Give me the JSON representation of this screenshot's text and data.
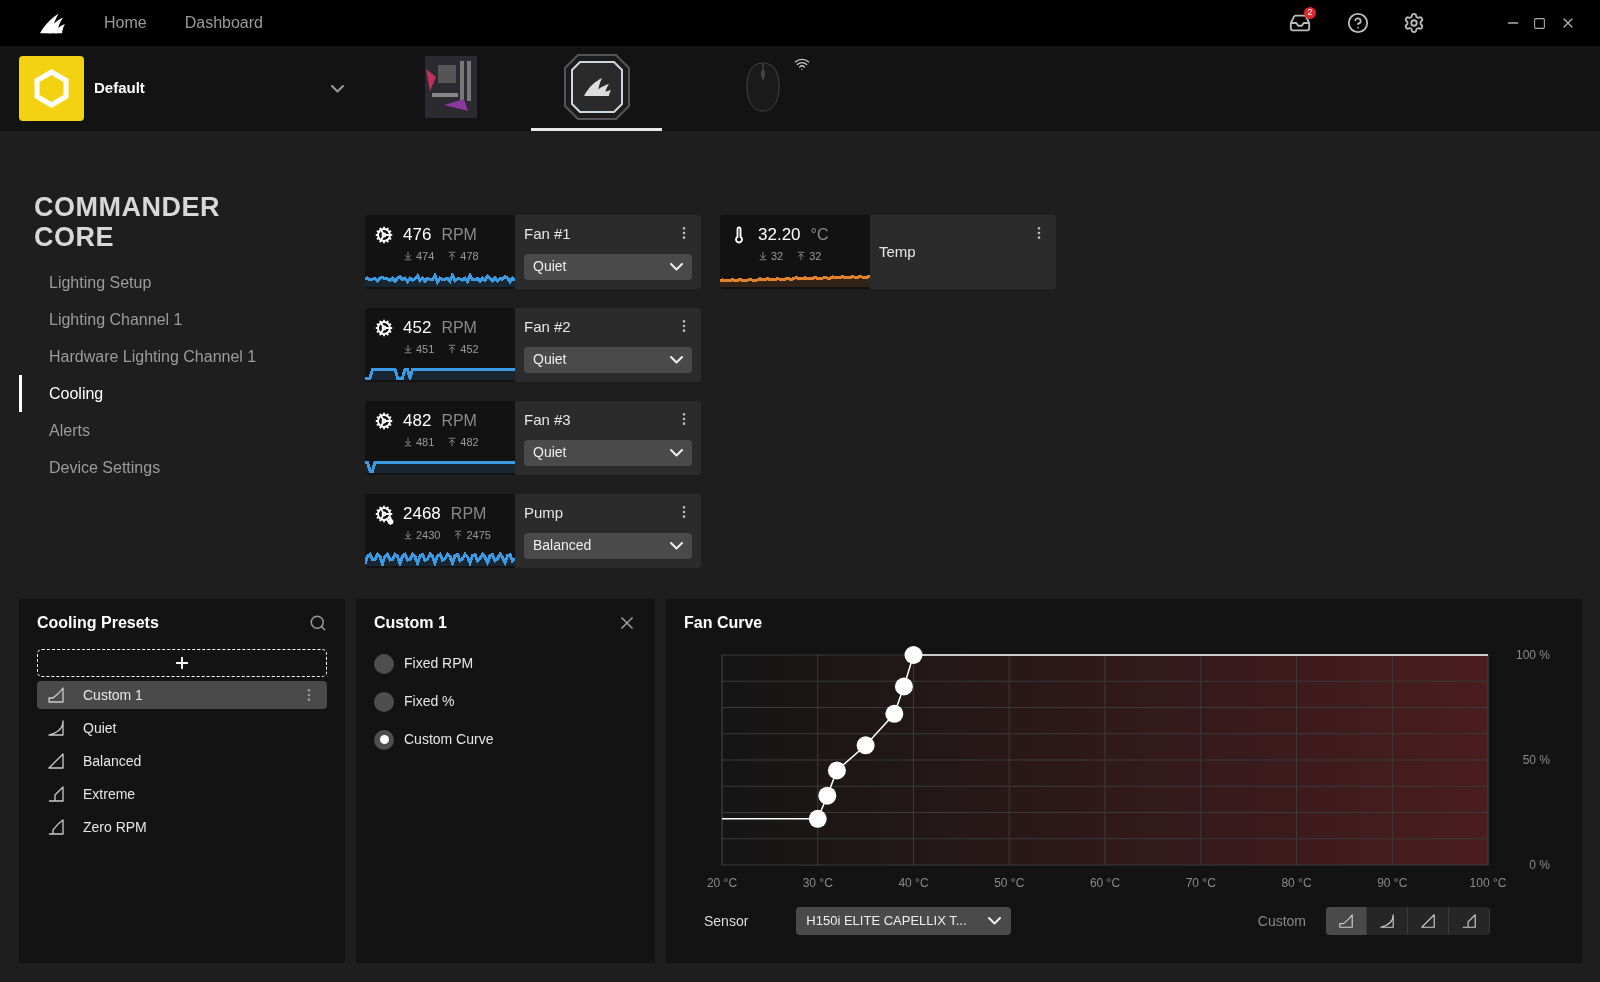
{
  "topbar": {
    "nav": [
      {
        "label": "Home",
        "selected": false
      },
      {
        "label": "Dashboard",
        "selected": false
      }
    ],
    "notification_count": "2"
  },
  "profile": {
    "name": "Default"
  },
  "devices": [
    {
      "kind": "motherboard",
      "selected": false
    },
    {
      "kind": "cooler",
      "selected": true
    },
    {
      "kind": "mouse",
      "selected": false
    }
  ],
  "sidebar": {
    "title": "COMMANDER CORE",
    "items": [
      {
        "label": "Lighting Setup",
        "selected": false
      },
      {
        "label": "Lighting Channel 1",
        "selected": false
      },
      {
        "label": "Hardware Lighting Channel 1",
        "selected": false
      },
      {
        "label": "Cooling",
        "selected": true
      },
      {
        "label": "Alerts",
        "selected": false
      },
      {
        "label": "Device Settings",
        "selected": false
      }
    ]
  },
  "fans": [
    {
      "kind": "fan",
      "value": "476",
      "unit": "RPM",
      "min": "474",
      "max": "478",
      "name": "Fan #1",
      "preset": "Quiet",
      "color": "#3b9ae1"
    },
    {
      "kind": "fan",
      "value": "452",
      "unit": "RPM",
      "min": "451",
      "max": "452",
      "name": "Fan #2",
      "preset": "Quiet",
      "color": "#3b9ae1"
    },
    {
      "kind": "fan",
      "value": "482",
      "unit": "RPM",
      "min": "481",
      "max": "482",
      "name": "Fan #3",
      "preset": "Quiet",
      "color": "#3b9ae1"
    },
    {
      "kind": "pump",
      "value": "2468",
      "unit": "RPM",
      "min": "2430",
      "max": "2475",
      "name": "Pump",
      "preset": "Balanced",
      "color": "#3b9ae1"
    }
  ],
  "temps": [
    {
      "kind": "temp",
      "value": "32.20",
      "unit": "°C",
      "min": "32",
      "max": "32",
      "name": "Temp",
      "color": "#e2832c"
    }
  ],
  "presets": {
    "title": "Cooling Presets",
    "items": [
      {
        "name": "Custom 1",
        "kind": "custom",
        "selected": true
      },
      {
        "name": "Quiet",
        "kind": "quiet",
        "selected": false
      },
      {
        "name": "Balanced",
        "kind": "balanced",
        "selected": false
      },
      {
        "name": "Extreme",
        "kind": "extreme",
        "selected": false
      },
      {
        "name": "Zero RPM",
        "kind": "zero",
        "selected": false
      }
    ]
  },
  "editor": {
    "title": "Custom 1",
    "modes": [
      {
        "label": "Fixed RPM",
        "selected": false
      },
      {
        "label": "Fixed %",
        "selected": false
      },
      {
        "label": "Custom Curve",
        "selected": true
      }
    ]
  },
  "fan_curve": {
    "title": "Fan Curve",
    "chart_data": {
      "type": "line",
      "xlim": [
        20,
        100
      ],
      "ylim": [
        0,
        100
      ],
      "x": [
        20,
        30,
        31,
        32,
        35,
        38,
        39,
        40,
        100
      ],
      "xticks": [
        {
          "value": 20,
          "label": "20 °C"
        },
        {
          "value": 30,
          "label": "30 °C"
        },
        {
          "value": 40,
          "label": "40 °C"
        },
        {
          "value": 50,
          "label": "50 °C"
        },
        {
          "value": 60,
          "label": "60 °C"
        },
        {
          "value": 70,
          "label": "70 °C"
        },
        {
          "value": 80,
          "label": "80 °C"
        },
        {
          "value": 90,
          "label": "90 °C"
        },
        {
          "value": 100,
          "label": "100 °C"
        }
      ],
      "yticks": [
        {
          "value": 0,
          "label": "0 %"
        },
        {
          "value": 50,
          "label": "50 %"
        },
        {
          "value": 100,
          "label": "100 %"
        }
      ],
      "grid": true,
      "series": [
        {
          "color": "#ffffff",
          "values": [
            22,
            22,
            33,
            45,
            57,
            72,
            85,
            100,
            100
          ]
        }
      ]
    },
    "sensor_label": "Sensor",
    "sensor": "H150i ELITE CAPELLIX T...",
    "curve_label": "Custom",
    "curve_buttons": [
      {
        "kind": "custom",
        "selected": true
      },
      {
        "kind": "quiet",
        "selected": false
      },
      {
        "kind": "balanced",
        "selected": false
      },
      {
        "kind": "extreme",
        "selected": false
      }
    ]
  }
}
